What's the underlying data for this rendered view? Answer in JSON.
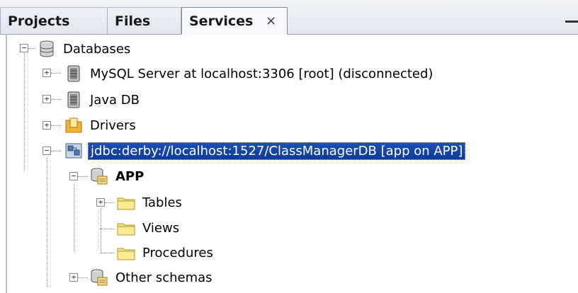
{
  "tabs": [
    {
      "label": "Projects",
      "active": false
    },
    {
      "label": "Files",
      "active": false
    },
    {
      "label": "Services",
      "active": true,
      "close_glyph": "×"
    }
  ],
  "tree": {
    "root": {
      "label": "Databases",
      "icon": "database-stack-icon",
      "expanded": true
    },
    "connections": [
      {
        "label": "MySQL Server at localhost:3306 [root] (disconnected)",
        "icon": "db-server-icon",
        "expanded": false
      },
      {
        "label": "Java DB",
        "icon": "db-server-icon",
        "expanded": false
      },
      {
        "label": "Drivers",
        "icon": "drivers-folder-icon",
        "expanded": false
      },
      {
        "label": "jdbc:derby://localhost:1527/ClassManagerDB [app on APP]",
        "icon": "db-connection-icon",
        "expanded": true,
        "selected": true
      }
    ],
    "schema": {
      "label": "APP",
      "icon": "schema-icon",
      "expanded": true
    },
    "schema_children": [
      {
        "label": "Tables",
        "icon": "folder-icon",
        "expandable": true
      },
      {
        "label": "Views",
        "icon": "folder-icon",
        "expandable": false
      },
      {
        "label": "Procedures",
        "icon": "folder-icon",
        "expandable": false
      }
    ],
    "other": {
      "label": "Other schemas",
      "icon": "schema-icon",
      "expanded": false
    }
  },
  "colors": {
    "selection_bg": "#0d3a9c",
    "folder_yellow": "#f6e27a",
    "drivers_orange": "#f2b233"
  }
}
